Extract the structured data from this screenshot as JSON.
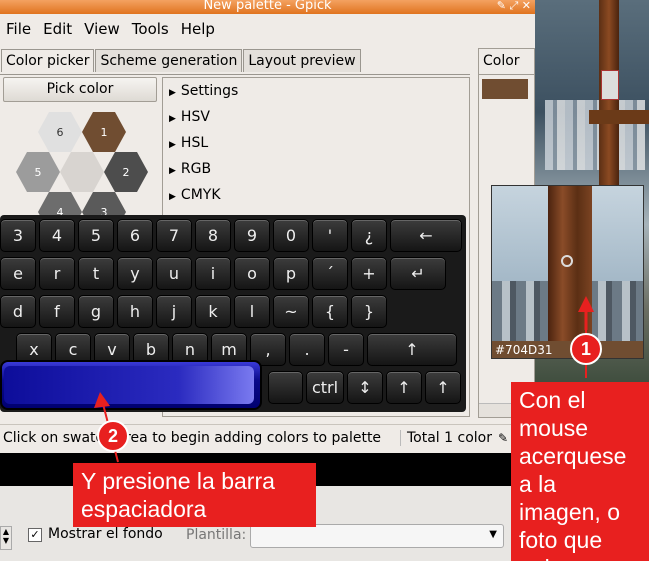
{
  "window": {
    "title": "New palette - Gpick"
  },
  "menu": [
    "File",
    "Edit",
    "View",
    "Tools",
    "Help"
  ],
  "tabs": [
    "Color picker",
    "Scheme generation",
    "Layout preview"
  ],
  "pick_color_button": "Pick color",
  "hexagons": [
    {
      "n": "6",
      "color": "#e0e0e0"
    },
    {
      "n": "1",
      "color": "#704D31"
    },
    {
      "n": "5",
      "color": "#9c9c9c"
    },
    {
      "n": "2",
      "color": "#4d4d4d"
    },
    {
      "n": "4",
      "color": "#6d6d6d"
    },
    {
      "n": "3",
      "color": "#5a5a5a"
    },
    {
      "n": "",
      "color": "#d8d4d0"
    }
  ],
  "tree_items": [
    "Settings",
    "HSV",
    "HSL",
    "RGB",
    "CMYK"
  ],
  "right_panel": {
    "header": "Color",
    "swatch_color": "#704D31"
  },
  "status": {
    "left": "Click on swatch area to begin adding colors to palette",
    "right": "Total 1 color"
  },
  "bottom": {
    "checkbox_label": "Mostrar el fondo",
    "combo_label": "Plantilla:"
  },
  "magnifier": {
    "hex": "#704D31"
  },
  "keyboard": {
    "row1": [
      "3",
      "4",
      "5",
      "6",
      "7",
      "8",
      "9",
      "0",
      "'",
      "¿",
      "←"
    ],
    "row2": [
      "e",
      "r",
      "t",
      "y",
      "u",
      "i",
      "o",
      "p",
      "´",
      "+",
      "↵"
    ],
    "row3": [
      "d",
      "f",
      "g",
      "h",
      "j",
      "k",
      "l",
      "~",
      "{",
      "}"
    ],
    "row4": [
      "x",
      "c",
      "v",
      "b",
      "n",
      "m",
      ",",
      ".",
      "-",
      "↑"
    ],
    "row5": [
      "ctrl",
      "↕",
      "↑",
      "↑",
      "←",
      "↓",
      "→"
    ]
  },
  "annotations": {
    "callout1": "Con el mouse acerquese a la imagen, o foto que quiera",
    "callout2": "Y presione la barra espaciadora",
    "badge1": "1",
    "badge2": "2"
  }
}
